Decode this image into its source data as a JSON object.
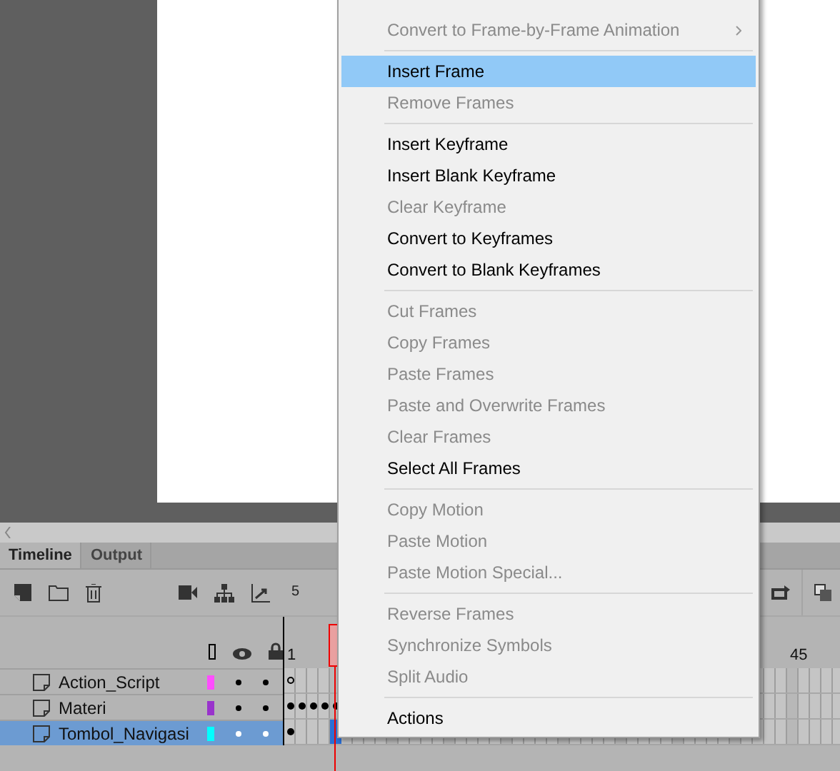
{
  "context_menu": {
    "items": [
      {
        "kind": "item",
        "label": "Convert to Frame-by-Frame Animation",
        "disabled": true,
        "selected": false,
        "submenu": true
      },
      {
        "kind": "separator"
      },
      {
        "kind": "item",
        "label": "Insert Frame",
        "disabled": false,
        "selected": true
      },
      {
        "kind": "item",
        "label": "Remove Frames",
        "disabled": true,
        "selected": false
      },
      {
        "kind": "separator"
      },
      {
        "kind": "item",
        "label": "Insert Keyframe",
        "disabled": false,
        "selected": false
      },
      {
        "kind": "item",
        "label": "Insert Blank Keyframe",
        "disabled": false,
        "selected": false
      },
      {
        "kind": "item",
        "label": "Clear Keyframe",
        "disabled": true,
        "selected": false
      },
      {
        "kind": "item",
        "label": "Convert to Keyframes",
        "disabled": false,
        "selected": false
      },
      {
        "kind": "item",
        "label": "Convert to Blank Keyframes",
        "disabled": false,
        "selected": false
      },
      {
        "kind": "separator"
      },
      {
        "kind": "item",
        "label": "Cut Frames",
        "disabled": true,
        "selected": false
      },
      {
        "kind": "item",
        "label": "Copy Frames",
        "disabled": true,
        "selected": false
      },
      {
        "kind": "item",
        "label": "Paste Frames",
        "disabled": true,
        "selected": false
      },
      {
        "kind": "item",
        "label": "Paste and Overwrite Frames",
        "disabled": true,
        "selected": false
      },
      {
        "kind": "item",
        "label": "Clear Frames",
        "disabled": true,
        "selected": false
      },
      {
        "kind": "item",
        "label": "Select All Frames",
        "disabled": false,
        "selected": false
      },
      {
        "kind": "separator"
      },
      {
        "kind": "item",
        "label": "Copy Motion",
        "disabled": true,
        "selected": false
      },
      {
        "kind": "item",
        "label": "Paste Motion",
        "disabled": true,
        "selected": false
      },
      {
        "kind": "item",
        "label": "Paste Motion Special...",
        "disabled": true,
        "selected": false
      },
      {
        "kind": "separator"
      },
      {
        "kind": "item",
        "label": "Reverse Frames",
        "disabled": true,
        "selected": false
      },
      {
        "kind": "item",
        "label": "Synchronize Symbols",
        "disabled": true,
        "selected": false
      },
      {
        "kind": "item",
        "label": "Split Audio",
        "disabled": true,
        "selected": false
      },
      {
        "kind": "separator"
      },
      {
        "kind": "item",
        "label": "Actions",
        "disabled": false,
        "selected": false
      }
    ]
  },
  "panel_tabs": [
    {
      "label": "Timeline",
      "selected": true
    },
    {
      "label": "Output",
      "selected": false
    }
  ],
  "timeline": {
    "current_frame": "5",
    "ruler": [
      "1",
      "45"
    ],
    "layers": [
      {
        "name": "Action_Script",
        "color": "#ff4dff",
        "selected": false,
        "frames": [
          {
            "kind": "hollow"
          }
        ]
      },
      {
        "name": "Materi",
        "color": "#9933cc",
        "selected": false,
        "frames": [
          {
            "kind": "filled"
          },
          {
            "kind": "filled"
          },
          {
            "kind": "filled"
          },
          {
            "kind": "filled"
          },
          {
            "kind": "filled"
          }
        ]
      },
      {
        "name": "Tombol_Navigasi",
        "color": "#00ffff",
        "selected": true,
        "frames": [
          {
            "kind": "filled"
          }
        ]
      }
    ]
  }
}
